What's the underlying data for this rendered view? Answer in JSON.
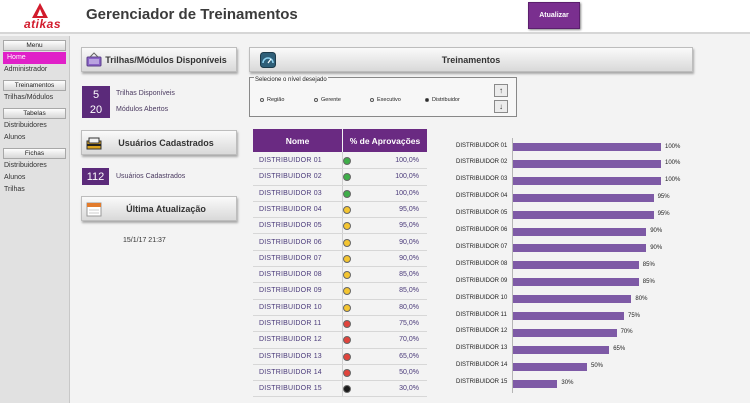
{
  "header": {
    "logo_text": "atikas",
    "title": "Gerenciador de Treinamentos",
    "update_button": "Atualizar"
  },
  "sidebar": {
    "menu_header": "Menu",
    "home": "Home",
    "admin": "Administrador",
    "treinamentos_header": "Treinamentos",
    "trilhas_modulos": "Trilhas/Módulos",
    "tabelas_header": "Tabelas",
    "tabelas_distribuidores": "Distribuidores",
    "tabelas_alunos": "Alunos",
    "fichas_header": "Fichas",
    "fichas_distribuidores": "Distribuidores",
    "fichas_alunos": "Alunos",
    "fichas_trilhas": "Trilhas"
  },
  "panels": {
    "trilhas_title": "Trilhas/Módulos Disponíveis",
    "trilhas_count": "5",
    "trilhas_label": "Trilhas Disponíveis",
    "modulos_count": "20",
    "modulos_label": "Módulos Abertos",
    "usuarios_title": "Usuários Cadastrados",
    "usuarios_count": "112",
    "usuarios_label": "Usuários Cadastrados",
    "ultima_title": "Última Atualização",
    "ultima_value": "15/1/17 21:37",
    "treinamentos_title": "Treinamentos"
  },
  "filter": {
    "legend": "Selecione o nível desejado",
    "options": [
      "Região",
      "Gerente",
      "Executivo",
      "Distribuidor"
    ],
    "selected": "Distribuidor"
  },
  "table": {
    "col_name": "Nome",
    "col_pct": "% de Aprovações",
    "rows": [
      {
        "name": "DISTRIBUIDOR 01",
        "pct": "100,0%",
        "status": "green"
      },
      {
        "name": "DISTRIBUIDOR 02",
        "pct": "100,0%",
        "status": "green"
      },
      {
        "name": "DISTRIBUIDOR 03",
        "pct": "100,0%",
        "status": "green"
      },
      {
        "name": "DISTRIBUIDOR 04",
        "pct": "95,0%",
        "status": "yellow"
      },
      {
        "name": "DISTRIBUIDOR 05",
        "pct": "95,0%",
        "status": "yellow"
      },
      {
        "name": "DISTRIBUIDOR 06",
        "pct": "90,0%",
        "status": "yellow"
      },
      {
        "name": "DISTRIBUIDOR 07",
        "pct": "90,0%",
        "status": "yellow"
      },
      {
        "name": "DISTRIBUIDOR 08",
        "pct": "85,0%",
        "status": "yellow"
      },
      {
        "name": "DISTRIBUIDOR 09",
        "pct": "85,0%",
        "status": "yellow"
      },
      {
        "name": "DISTRIBUIDOR 10",
        "pct": "80,0%",
        "status": "yellow"
      },
      {
        "name": "DISTRIBUIDOR 11",
        "pct": "75,0%",
        "status": "red"
      },
      {
        "name": "DISTRIBUIDOR 12",
        "pct": "70,0%",
        "status": "red"
      },
      {
        "name": "DISTRIBUIDOR 13",
        "pct": "65,0%",
        "status": "red"
      },
      {
        "name": "DISTRIBUIDOR 14",
        "pct": "50,0%",
        "status": "red"
      },
      {
        "name": "DISTRIBUIDOR 15",
        "pct": "30,0%",
        "status": "black"
      }
    ]
  },
  "status_colors": {
    "green": "#3fae49",
    "yellow": "#f4c531",
    "red": "#e0443c",
    "black": "#1a1a1a"
  },
  "chart_data": {
    "type": "bar",
    "orientation": "horizontal",
    "categories": [
      "DISTRIBUIDOR 01",
      "DISTRIBUIDOR 02",
      "DISTRIBUIDOR 03",
      "DISTRIBUIDOR 04",
      "DISTRIBUIDOR 05",
      "DISTRIBUIDOR 06",
      "DISTRIBUIDOR 07",
      "DISTRIBUIDOR 08",
      "DISTRIBUIDOR 09",
      "DISTRIBUIDOR 10",
      "DISTRIBUIDOR 11",
      "DISTRIBUIDOR 12",
      "DISTRIBUIDOR 13",
      "DISTRIBUIDOR 14",
      "DISTRIBUIDOR 15"
    ],
    "values": [
      100,
      100,
      100,
      95,
      95,
      90,
      90,
      85,
      85,
      80,
      75,
      70,
      65,
      50,
      30
    ],
    "value_labels": [
      "100%",
      "100%",
      "100%",
      "95%",
      "95%",
      "90%",
      "90%",
      "85%",
      "85%",
      "80%",
      "75%",
      "70%",
      "65%",
      "50%",
      "30%"
    ],
    "xlim": [
      0,
      100
    ],
    "bar_color": "#7e5aa6",
    "grid": false
  }
}
